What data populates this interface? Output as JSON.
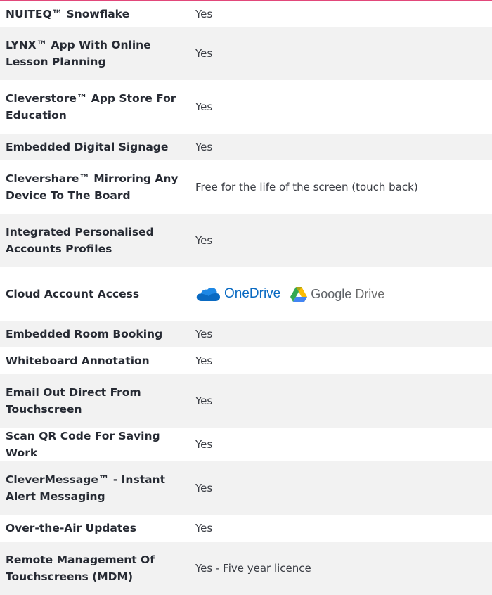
{
  "rows": [
    {
      "feature": "NUITEQ™ Snowflake",
      "value": "Yes"
    },
    {
      "feature": "LYNX™ App With Online Lesson Planning",
      "value": "Yes"
    },
    {
      "feature": "Cleverstore™ App Store For Education",
      "value": "Yes"
    },
    {
      "feature": "Embedded Digital Signage",
      "value": "Yes"
    },
    {
      "feature": "Clevershare™ Mirroring Any Device To The Board",
      "value": "Free for the life of the screen (touch back)"
    },
    {
      "feature": "Integrated Personalised Accounts Profiles",
      "value": "Yes"
    },
    {
      "feature": "Cloud Account Access",
      "onedrive_label": "OneDrive",
      "gdrive_label_google": "Google",
      "gdrive_label_drive": "Drive"
    },
    {
      "feature": "Embedded Room Booking",
      "value": "Yes"
    },
    {
      "feature": "Whiteboard Annotation",
      "value": "Yes"
    },
    {
      "feature": "Email Out Direct From Touchscreen",
      "value": "Yes"
    },
    {
      "feature": "Scan QR Code For Saving Work",
      "value": "Yes"
    },
    {
      "feature": "CleverMessage™ - Instant Alert Messaging",
      "value": "Yes"
    },
    {
      "feature": "Over-the-Air Updates",
      "value": "Yes"
    },
    {
      "feature": "Remote Management Of Touchscreens (MDM)",
      "value": "Yes - Five year licence"
    }
  ],
  "colors": {
    "accent_rule": "#e2477a",
    "row_alt": "#f2f2f2",
    "onedrive_blue": "#0a6ac2"
  }
}
